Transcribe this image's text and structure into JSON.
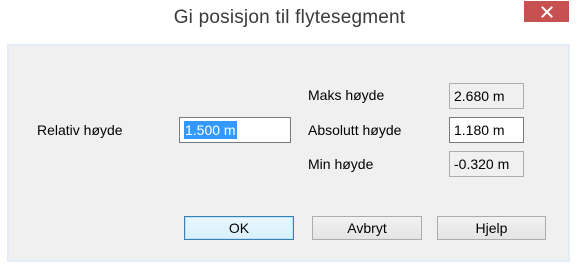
{
  "window": {
    "title": "Gi posisjon til flytesegment"
  },
  "icons": {
    "close": "close-icon"
  },
  "form": {
    "relative_label": "Relativ høyde",
    "relative_value": "1.500 m",
    "max_label": "Maks høyde",
    "max_value": "2.680 m",
    "absolute_label": "Absolutt høyde",
    "absolute_value": "1.180 m",
    "min_label": "Min høyde",
    "min_value": "-0.320 m"
  },
  "buttons": {
    "ok": "OK",
    "cancel": "Avbryt",
    "help": "Hjelp"
  },
  "colors": {
    "close_button": "#c75050",
    "selection": "#3399ff"
  }
}
